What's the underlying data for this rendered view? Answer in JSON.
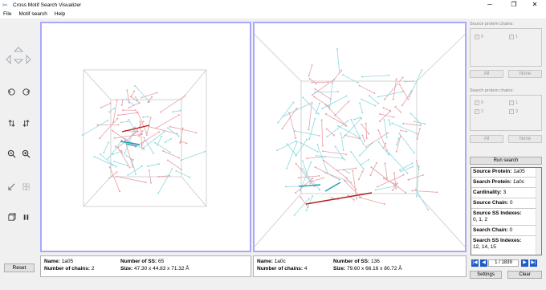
{
  "window": {
    "title": "Cross Motif Search Visualizer",
    "minimize": "─",
    "maximize": "❐",
    "close": "✕"
  },
  "menu": [
    "File",
    "Motif search",
    "Help"
  ],
  "toolbar": {
    "reset_label": "Reset"
  },
  "left_view": {
    "name_label": "Name:",
    "name_value": "1a05",
    "chains_label": "Number of chains:",
    "chains_value": "2",
    "ss_label": "Number of SS:",
    "ss_value": "65",
    "size_label": "Size:",
    "size_value": "47.30 x 44.83 x 71.32 Å"
  },
  "right_view": {
    "name_label": "Name:",
    "name_value": "1a0c",
    "chains_label": "Number of chains:",
    "chains_value": "4",
    "ss_label": "Number of SS:",
    "ss_value": "136",
    "size_label": "Size:",
    "size_value": "79.60 x 66.16 x 80.72 Å"
  },
  "source_chains": {
    "label": "Source protein chains:",
    "items": [
      "0",
      "1"
    ],
    "all_label": "All",
    "none_label": "None"
  },
  "search_chains": {
    "label": "Search protein chains:",
    "items": [
      "0",
      "1",
      "2",
      "3"
    ],
    "all_label": "All",
    "none_label": "None"
  },
  "run_search_label": "Run search",
  "details": {
    "source_protein_label": "Source Protein:",
    "source_protein_value": "1a05",
    "search_protein_label": "Search Protein:",
    "search_protein_value": "1a0c",
    "cardinality_label": "Cardinality:",
    "cardinality_value": "3",
    "source_chain_label": "Source Chain:",
    "source_chain_value": "0",
    "source_ss_label": "Source SS Indexes:",
    "source_ss_value": "0, 1, 2",
    "search_chain_label": "Search Chain:",
    "search_chain_value": "0",
    "search_ss_label": "Search SS Indexes:",
    "search_ss_value": "12, 14, 15"
  },
  "pager": {
    "value": "1 / 1839",
    "first": "|◀",
    "prev": "◀",
    "next": "▶",
    "last": "▶|"
  },
  "settings_label": "Settings",
  "clear_label": "Clear",
  "colors": {
    "viewport_border": "#a8a8ff",
    "chain_red": "#e8a0a8",
    "chain_cyan": "#90d8e0",
    "motif_red": "#c01818",
    "motif_cyan": "#1aa0b0",
    "nav_blue": "#1e5bc6"
  }
}
